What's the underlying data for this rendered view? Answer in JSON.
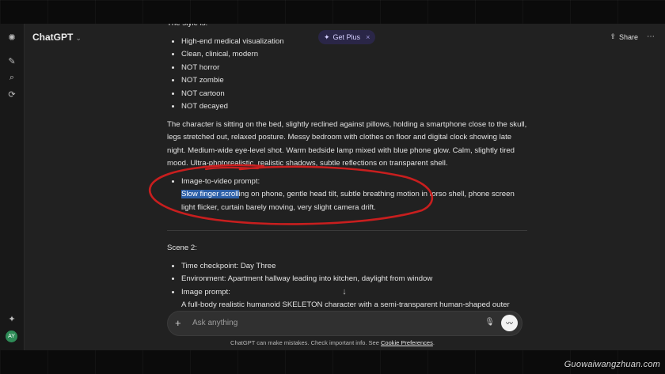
{
  "topbar": {
    "model": "ChatGPT",
    "get_plus": "Get Plus",
    "share": "Share"
  },
  "content": {
    "style_heading": "The style is:",
    "style_items": [
      "High-end medical visualization",
      "Clean, clinical, modern",
      "NOT horror",
      "NOT zombie",
      "NOT cartoon",
      "NOT decayed"
    ],
    "description": "The character is sitting on the bed, slightly reclined against pillows, holding a smartphone close to the skull, legs stretched out, relaxed posture. Messy bedroom with clothes on floor and digital clock showing late night. Medium-wide eye-level shot. Warm bedside lamp mixed with blue phone glow. Calm, slightly tired mood. Ultra-photorealistic, realistic shadows, subtle reflections on transparent shell.",
    "i2v_label": "Image-to-video prompt:",
    "i2v_highlight": "Slow finger scroll",
    "i2v_rest": "ing on phone, gentle head tilt, subtle breathing motion in torso shell, phone screen light flicker, curtain barely moving, very slight camera drift.",
    "scene2_title": "Scene 2:",
    "scene2_items": [
      "Time checkpoint: Day Three",
      "Environment: Apartment hallway leading into kitchen, daylight from window"
    ],
    "image_prompt_label": "Image prompt:",
    "image_prompt_text": "A full-body realistic humanoid SKELETON character with a semi-transparent human-shaped outer"
  },
  "composer": {
    "placeholder": "Ask anything"
  },
  "disclaimer": {
    "text": "ChatGPT can make mistakes. Check important info. See ",
    "link": "Cookie Preferences",
    "suffix": "."
  },
  "watermark": "Guowaiwangzhuan.com",
  "colors": {
    "highlight": "#2c5fa8",
    "annotation_red": "#c81e1e",
    "get_plus_bg": "#2a2647"
  }
}
